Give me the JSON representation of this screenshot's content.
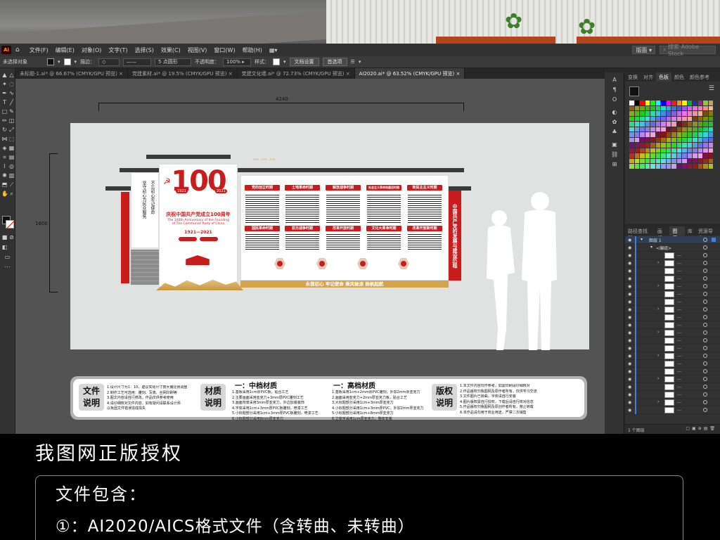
{
  "menubar": {
    "logo": "Ai",
    "items": [
      "文件(F)",
      "编辑(E)",
      "对象(O)",
      "文字(T)",
      "选择(S)",
      "效果(C)",
      "视图(V)",
      "窗口(W)",
      "帮助(H)"
    ],
    "workspace": "版面",
    "search_placeholder": "搜索 Adobe Stock"
  },
  "ctrlbar": {
    "selection_state": "未选择对象",
    "stroke_label": "描边：",
    "profile": "5 点圆形",
    "opacity_label": "不透明度：",
    "opacity_value": "100%",
    "style_label": "样式：",
    "doc_settings": "文档设置",
    "preferences": "首选项"
  },
  "tabs": [
    "未标题-1.ai* @ 66.67% (CMYK/GPU 预览)",
    "党建素材.ai* @ 19.5% (CMYK/GPU 预览)",
    "党建文化墙.ai* @ 72.73% (CMYK/GPU 预览)",
    "AI2020.ai* @ 63.52% (CMYK/GPU 预览)"
  ],
  "active_tab": 3,
  "dimensions": {
    "width": "4240",
    "height": "1600"
  },
  "design": {
    "logo_numbers": {
      "big": "100",
      "y1": "1921",
      "y2": "2021"
    },
    "centenary_title": "庆祝中国共产党成立100周年",
    "centenary_en": "The 100th Anniversary of the Founding of The Communist Party of China",
    "years": "1921—2021",
    "left_vertical_1": "不忘初心牢记使命",
    "left_vertical_2": "坚守初心为民众服务",
    "right_vertical": "中国共产党的发展与建设历程",
    "top_headers": [
      "党的创立时期",
      "土地革命时期",
      "解放战争时期",
      "社会主义革命和建设时期",
      "新民主主义时期"
    ],
    "bottom_headers": [
      "国民革命时期",
      "抗日战争时期",
      "改革开放时期",
      "文化大革命时期",
      "改革开放新时期"
    ],
    "slogan": "永葆初心 牢记使命 乘风破浪 扬帆起航"
  },
  "infobar": {
    "tag1": [
      "文件",
      "说明"
    ],
    "tag2": [
      "材质",
      "说明"
    ],
    "tag3": [
      "版权",
      "说明"
    ],
    "mid_title": "一：中档材质",
    "high_title": "一：高档材质",
    "block1": [
      "1.设计尺寸为1：10，建议实际尺寸按大偏比例调整",
      "2.制作工艺可选用：雕刻、写真、丝网印刷等",
      "3.图文内容请自行修改，作品仅供参考使用",
      "4.请仔细核对文件内容，如有疑问请联系设计师",
      "   以免因文件错误造成损失"
    ],
    "block2": [
      "1.基板采用1cm厚PVC板，贴合工艺",
      "2.主要画面采用亚克力+3mm厚PVC雕刻工艺",
      "3.画面背景采用3mm厚亚克力，外边加装装饰",
      "4.字体采用1cm+3mm厚PVC板雕刻，喷漆工艺",
      "5.小标题部分采用1cm+3mm厚PVC板雕刻，喷漆工艺",
      "6.小标题部分采用8mm厚亚克力"
    ],
    "block3": [
      "1.基板采用1cm+2mm厚PVC雕刻，外加2mm厚亚克力",
      "2.画面采用亚克力+2mm厚亚克力板，贴合工艺",
      "3.大标题部分采用1cm+3mm厚亚克力",
      "4.小标题部分采用1cm+3mm厚PVC，外加2mm厚亚克力",
      "5.小标题部分采用1cm+8mm厚亚克力",
      "6.立体字采用1cm厚亚克力，整体安装"
    ],
    "block4": [
      "1.本文件内容仅作参考，如需印刷请仔细核对",
      "2.作品版权归我图网及原作者所有，仅供学习交流",
      "3.文件图片已转曲，字体请自行安装",
      "4.图片版权需自行授权，下载后请自行核对信息",
      "5.作品版权归我图网及原创作者所有，禁止转载",
      "6.本作品请勿用于商业用途，严禁二次销售"
    ]
  },
  "panels": {
    "swatch_tabs": [
      "变换",
      "对齐",
      "色板",
      "颜色",
      "颜色参考"
    ],
    "layer_tabs": [
      "路径查找器",
      "画板",
      "图层",
      "库",
      "资源导出"
    ],
    "layer_name": "图层 1",
    "group_name": "<编组>",
    "layer_count": "1 个图层"
  },
  "banner": "我图网正版授权",
  "includes": {
    "heading": "文件包含：",
    "line1": "①：AI2020/AICS格式文件（含转曲、未转曲）"
  },
  "colors": {
    "party_red": "#c91d1d",
    "gold": "#d4a44d",
    "ui_dark": "#323232",
    "selection_blue": "#4a7bd5"
  }
}
